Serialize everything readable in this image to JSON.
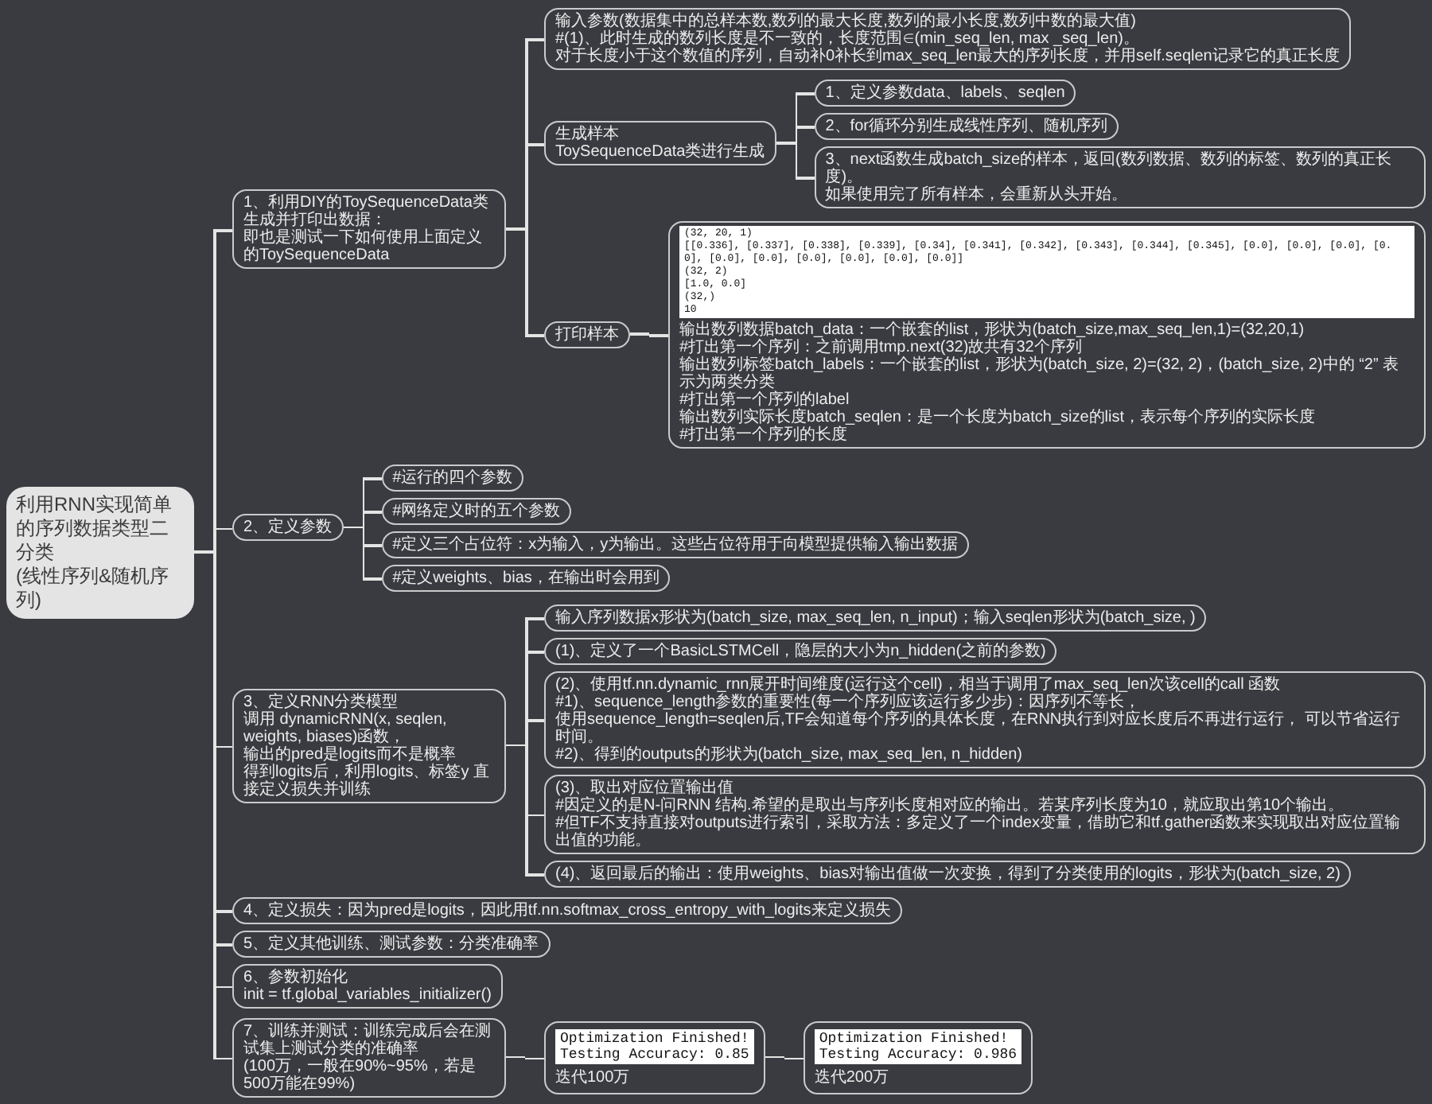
{
  "root": {
    "lines": [
      "利用RNN实现简单的序列数据类型二分类",
      "(线性序列&随机序列)"
    ],
    "children": [
      {
        "kind": "text",
        "lines": [
          "1、利用DIY的ToySequenceData类生成并打印出数据：",
          "即也是测试一下如何使用上面定义的ToySequenceData"
        ],
        "children": [
          {
            "kind": "text",
            "lines": [
              "输入参数(数据集中的总样本数,数列的最大长度,数列的最小长度,数列中数的最大值)",
              "#(1)、此时生成的数列长度是不一致的，长度范围∈(min_seq_len, max _seq_len)。",
              "对于长度小于这个数值的序列，自动补0补长到max_seq_len最大的序列长度，并用self.seqlen记录它的真正长度"
            ]
          },
          {
            "kind": "text",
            "lines": [
              "生成样本",
              "ToySequenceData类进行生成"
            ],
            "children": [
              {
                "kind": "text",
                "lines": [
                  "1、定义参数data、labels、seqlen"
                ]
              },
              {
                "kind": "text",
                "lines": [
                  "2、for循环分别生成线性序列、随机序列"
                ]
              },
              {
                "kind": "text",
                "lines": [
                  "3、next函数生成batch_size的样本，返回(数列数据、数列的标签、数列的真正长度)。",
                  "如果使用完了所有样本，会重新从头开始。"
                ]
              }
            ]
          },
          {
            "kind": "text",
            "lines": [
              "打印样本"
            ],
            "children": [
              {
                "kind": "sample",
                "code": [
                  "(32, 20, 1)",
                  "[[0.336], [0.337], [0.338], [0.339], [0.34], [0.341], [0.342], [0.343], [0.344], [0.345], [0.0], [0.0], [0.0], [0.0], [0.0], [0.0], [0.0], [0.0], [0.0], [0.0]]",
                  "(32, 2)",
                  "[1.0, 0.0]",
                  "(32,)",
                  "10"
                ],
                "lines": [
                  "输出数列数据batch_data：一个嵌套的list，形状为(batch_size,max_seq_len,1)=(32,20,1)",
                  "#打出第一个序列：之前调用tmp.next(32)故共有32个序列",
                  "输出数列标签batch_labels：一个嵌套的list，形状为(batch_size, 2)=(32, 2)，(batch_size, 2)中的 “2” 表示为两类分类",
                  "#打出第一个序列的label",
                  "输出数列实际长度batch_seqlen：是一个长度为batch_size的list，表示每个序列的实际长度",
                  "#打出第一个序列的长度"
                ]
              }
            ]
          }
        ]
      },
      {
        "kind": "text",
        "lines": [
          "2、定义参数"
        ],
        "children": [
          {
            "kind": "text",
            "lines": [
              "#运行的四个参数"
            ]
          },
          {
            "kind": "text",
            "lines": [
              "#网络定义时的五个参数"
            ]
          },
          {
            "kind": "text",
            "lines": [
              "#定义三个占位符：x为输入，y为输出。这些占位符用于向模型提供输入输出数据"
            ]
          },
          {
            "kind": "text",
            "lines": [
              "#定义weights、bias，在输出时会用到"
            ]
          }
        ]
      },
      {
        "kind": "text",
        "lines": [
          "3、定义RNN分类模型",
          "调用 dynamicRNN(x, seqlen, weights, biases)函数，",
          "输出的pred是logits而不是概率",
          "得到logits后，利用logits、标签y 直接定义损失并训练"
        ],
        "children": [
          {
            "kind": "text",
            "lines": [
              "输入序列数据x形状为(batch_size, max_seq_len, n_input)；输入seqlen形状为(batch_size, )"
            ]
          },
          {
            "kind": "text",
            "lines": [
              "(1)、定义了一个BasicLSTMCell，隐层的大小为n_hidden(之前的参数)"
            ]
          },
          {
            "kind": "text",
            "lines": [
              "(2)、使用tf.nn.dynamic_rnn展开时间维度(运行这个cell)，相当于调用了max_seq_len次该cell的call 函数",
              "#1)、sequence_length参数的重要性(每一个序列应该运行多少步)：因序列不等长，",
              "使用sequence_length=seqlen后,TF会知道每个序列的具体长度，在RNN执行到对应长度后不再进行运行， 可以节省运行时间。",
              "#2)、得到的outputs的形状为(batch_size, max_seq_len, n_hidden)"
            ]
          },
          {
            "kind": "text",
            "lines": [
              "(3)、取出对应位置输出值",
              "#因定义的是N-问RNN 结构.希望的是取出与序列长度相对应的输出。若某序列长度为10，就应取出第10个输出。",
              "#但TF不支持直接对outputs进行索引，采取方法：多定义了一个index变量，借助它和tf.gather函数来实现取出对应位置输出值的功能。"
            ]
          },
          {
            "kind": "text",
            "lines": [
              "(4)、返回最后的输出：使用weights、bias对输出值做一次变换，得到了分类使用的logits，形状为(batch_size, 2)"
            ]
          }
        ]
      },
      {
        "kind": "text",
        "lines": [
          "4、定义损失：因为pred是logits，因此用tf.nn.softmax_cross_entropy_with_logits来定义损失"
        ]
      },
      {
        "kind": "text",
        "lines": [
          "5、定义其他训练、测试参数：分类准确率"
        ]
      },
      {
        "kind": "text",
        "lines": [
          "6、参数初始化",
          "init = tf.global_variables_initializer()"
        ]
      },
      {
        "kind": "text",
        "lines": [
          "7、训练并测试：训练完成后会在测试集上测试分类的准确率",
          "(100万，一般在90%~95%，若是500万能在99%)"
        ],
        "children": [
          {
            "kind": "result",
            "code": [
              "Optimization Finished!",
              "Testing Accuracy: 0.85"
            ],
            "lines": [
              "迭代100万"
            ],
            "children": [
              {
                "kind": "result",
                "code": [
                  "Optimization Finished!",
                  "Testing Accuracy: 0.986"
                ],
                "lines": [
                  "迭代200万"
                ]
              }
            ]
          }
        ]
      }
    ]
  }
}
